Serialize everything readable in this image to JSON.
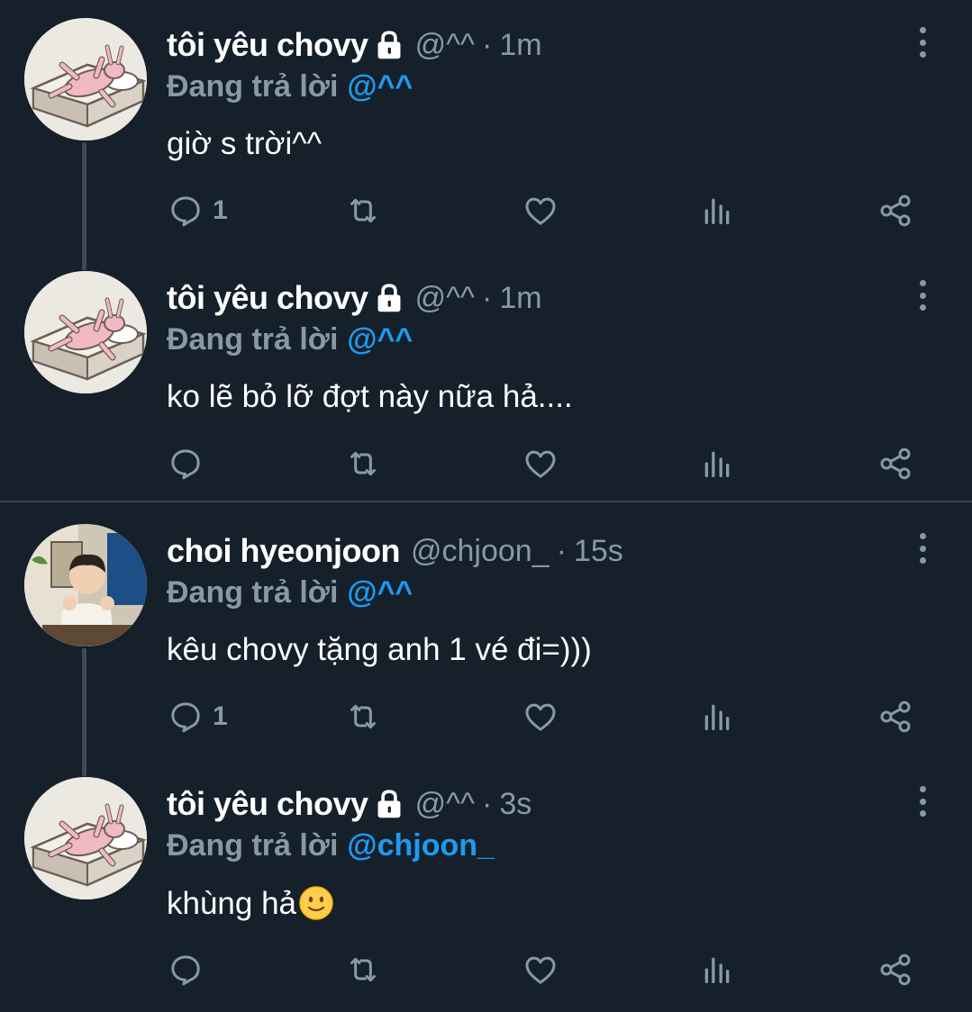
{
  "tweets": [
    {
      "display_name": "tôi yêu chovy",
      "handle": "@^^",
      "sep": "·",
      "time": "1m",
      "reply_prefix": "Đang trả lời",
      "reply_to": "@^^",
      "text": "giờ s trời^^",
      "reply_count": "1"
    },
    {
      "display_name": "tôi yêu chovy",
      "handle": "@^^",
      "sep": "·",
      "time": "1m",
      "reply_prefix": "Đang trả lời",
      "reply_to": "@^^",
      "text": "ko lẽ bỏ lỡ đợt này nữa hả....",
      "reply_count": ""
    },
    {
      "display_name": "choi hyeonjoon",
      "handle": "@chjoon_",
      "sep": "·",
      "time": "15s",
      "reply_prefix": "Đang trả lời",
      "reply_to": "@^^",
      "text": "kêu chovy tặng anh 1 vé đi=)))",
      "reply_count": "1"
    },
    {
      "display_name": "tôi yêu chovy",
      "handle": "@^^",
      "sep": "·",
      "time": "3s",
      "reply_prefix": "Đang trả lời",
      "reply_to": "@chjoon_",
      "text": "khùng hả",
      "reply_count": ""
    }
  ],
  "icons": {
    "lock": "lock-icon",
    "more": "more-icon",
    "reply": "reply-icon",
    "retweet": "retweet-icon",
    "like": "heart-icon",
    "stats": "stats-icon",
    "share": "share-icon",
    "smiley": "slightly-smiling-face-icon"
  },
  "colors": {
    "background": "#15202b",
    "text_primary": "#ffffff",
    "text_secondary": "#8899a6",
    "mention": "#1d9bf0",
    "thread_line": "#3d4a57",
    "divider": "#38444d"
  }
}
